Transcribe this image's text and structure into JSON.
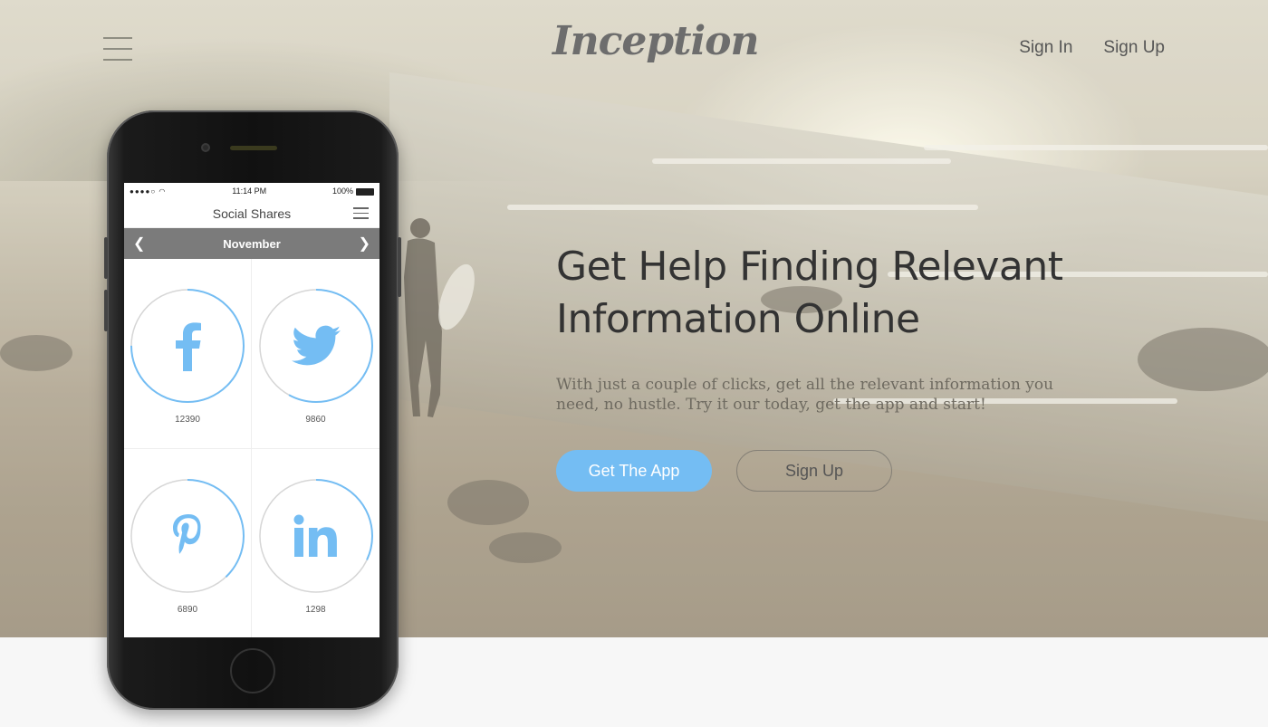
{
  "brand": {
    "logo_text": "Inception"
  },
  "nav": {
    "sign_in": "Sign In",
    "sign_up": "Sign Up"
  },
  "hero": {
    "headline": "Get Help Finding Relevant Information Online",
    "subtext": "With just a couple of clicks, get all the relevant information you need, no hustle. Try it our today, get the app and start!",
    "primary_button": "Get The App",
    "secondary_button": "Sign Up"
  },
  "phone": {
    "status": {
      "time": "11:14 PM",
      "battery": "100%"
    },
    "app_title": "Social Shares",
    "month": "November",
    "shares": [
      {
        "network": "facebook",
        "icon": "facebook-icon",
        "count": "12390",
        "progress": 0.75
      },
      {
        "network": "twitter",
        "icon": "twitter-icon",
        "count": "9860",
        "progress": 0.58
      },
      {
        "network": "pinterest",
        "icon": "pinterest-icon",
        "count": "6890",
        "progress": 0.38
      },
      {
        "network": "linkedin",
        "icon": "linkedin-icon",
        "count": "1298",
        "progress": 0.32
      }
    ]
  },
  "colors": {
    "accent": "#74bdf3",
    "ring_track": "#d6d6d6",
    "month_bar": "#7b7b7b"
  }
}
